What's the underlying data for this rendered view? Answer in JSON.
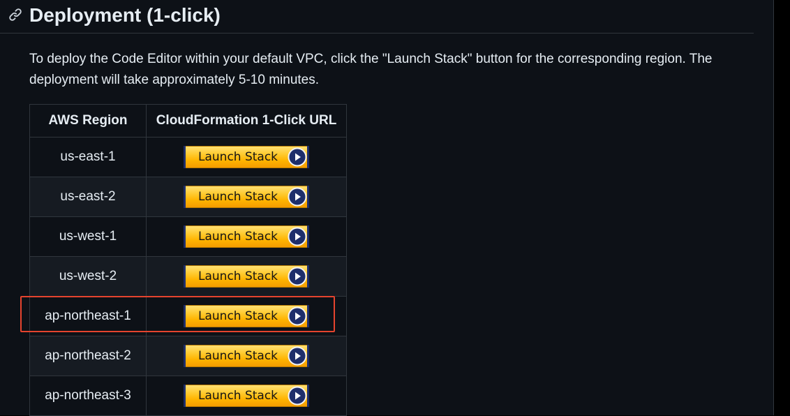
{
  "heading": "Deployment (1-click)",
  "intro": "To deploy the Code Editor within your default VPC, click the \"Launch Stack\" button for the corresponding region. The deployment will take approximately 5-10 minutes.",
  "table": {
    "headers": [
      "AWS Region",
      "CloudFormation 1-Click URL"
    ],
    "rows": [
      {
        "region": "us-east-1",
        "button": "Launch Stack"
      },
      {
        "region": "us-east-2",
        "button": "Launch Stack"
      },
      {
        "region": "us-west-1",
        "button": "Launch Stack"
      },
      {
        "region": "us-west-2",
        "button": "Launch Stack"
      },
      {
        "region": "ap-northeast-1",
        "button": "Launch Stack"
      },
      {
        "region": "ap-northeast-2",
        "button": "Launch Stack"
      },
      {
        "region": "ap-northeast-3",
        "button": "Launch Stack"
      }
    ]
  },
  "highlighted_row": "ap-northeast-1",
  "colors": {
    "background": "#0d1117",
    "text": "#e6edf3",
    "border": "#30363d",
    "highlight": "#e5442e",
    "button": "#ffb400",
    "button_icon": "#1e2e6b"
  },
  "icons": {
    "heading_anchor": "link-icon",
    "button": "play-circle-icon"
  }
}
